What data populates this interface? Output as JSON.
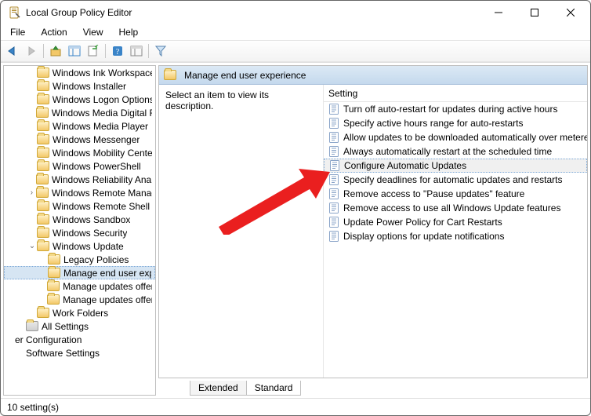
{
  "window": {
    "title": "Local Group Policy Editor"
  },
  "menu": {
    "file": "File",
    "action": "Action",
    "view": "View",
    "help": "Help"
  },
  "toolbar_icons": {
    "back": "back-arrow",
    "forward": "forward-arrow",
    "up": "up-folder",
    "show_hide": "panes",
    "export": "export-list",
    "help": "help",
    "props": "properties",
    "filter": "filter"
  },
  "tree": {
    "items": [
      {
        "indent": 1,
        "twisty": "",
        "label": "Windows Ink Workspace"
      },
      {
        "indent": 1,
        "twisty": "",
        "label": "Windows Installer"
      },
      {
        "indent": 1,
        "twisty": "",
        "label": "Windows Logon Options"
      },
      {
        "indent": 1,
        "twisty": "",
        "label": "Windows Media Digital Rig"
      },
      {
        "indent": 1,
        "twisty": "",
        "label": "Windows Media Player"
      },
      {
        "indent": 1,
        "twisty": "",
        "label": "Windows Messenger"
      },
      {
        "indent": 1,
        "twisty": "",
        "label": "Windows Mobility Center"
      },
      {
        "indent": 1,
        "twisty": "",
        "label": "Windows PowerShell"
      },
      {
        "indent": 1,
        "twisty": "",
        "label": "Windows Reliability Analys"
      },
      {
        "indent": 1,
        "twisty": ">",
        "label": "Windows Remote Manage"
      },
      {
        "indent": 1,
        "twisty": "",
        "label": "Windows Remote Shell"
      },
      {
        "indent": 1,
        "twisty": "",
        "label": "Windows Sandbox"
      },
      {
        "indent": 1,
        "twisty": "",
        "label": "Windows Security"
      },
      {
        "indent": 1,
        "twisty": "v",
        "label": "Windows Update"
      },
      {
        "indent": 2,
        "twisty": "",
        "label": "Legacy Policies"
      },
      {
        "indent": 2,
        "twisty": "",
        "label": "Manage end user expe",
        "selected": true
      },
      {
        "indent": 2,
        "twisty": "",
        "label": "Manage updates offere"
      },
      {
        "indent": 2,
        "twisty": "",
        "label": "Manage updates offere"
      },
      {
        "indent": 1,
        "twisty": "",
        "label": "Work Folders"
      },
      {
        "indent": 0,
        "twisty": "",
        "label": "All Settings",
        "icon": "settings"
      },
      {
        "indent": -1,
        "twisty": "",
        "label": "er Configuration",
        "icon": "none"
      },
      {
        "indent": 0,
        "twisty": "",
        "label": "Software Settings",
        "icon": "none"
      }
    ]
  },
  "content": {
    "header": "Manage end user experience",
    "description_prompt": "Select an item to view its description.",
    "column_header": "Setting",
    "settings": [
      "Turn off auto-restart for updates during active hours",
      "Specify active hours range for auto-restarts",
      "Allow updates to be downloaded automatically over metere",
      "Always automatically restart at the scheduled time",
      "Configure Automatic Updates",
      "Specify deadlines for automatic updates and restarts",
      "Remove access to \"Pause updates\" feature",
      "Remove access to use all Windows Update features",
      "Update Power Policy for Cart Restarts",
      "Display options for update notifications"
    ],
    "selected_index": 4
  },
  "tabs": {
    "extended": "Extended",
    "standard": "Standard"
  },
  "status": {
    "text": "10 setting(s)"
  }
}
